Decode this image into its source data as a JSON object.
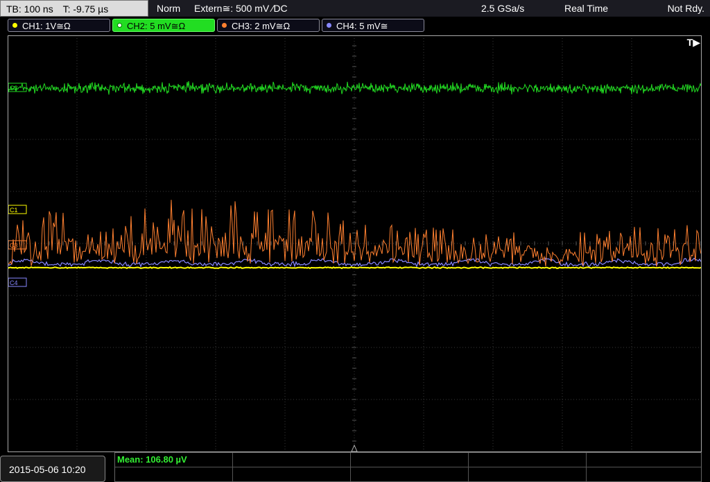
{
  "topbar": {
    "timebase": "TB: 100 ns",
    "trigger_time": "T: -9.75 µs",
    "trigger_mode": "Norm",
    "trigger_source": "Extern≅: 500 mV ∕DC",
    "sample_rate": "2.5 GSa/s",
    "acquisition_mode": "Real Time",
    "trigger_status": "Not Rdy."
  },
  "channels": [
    {
      "label": "CH1: 1V≅Ω",
      "color": "#ffff00",
      "active": false
    },
    {
      "label": "CH2: 5 mV≅Ω",
      "color": "#22dd22",
      "active": true
    },
    {
      "label": "CH3: 2 mV≅Ω",
      "color": "#ff8030",
      "active": false
    },
    {
      "label": "CH4: 5 mV≅",
      "color": "#8080ff",
      "active": false
    }
  ],
  "markers": {
    "c1": "C1",
    "c2": "C2",
    "c3": "C3",
    "c4": "C4",
    "trigger_indicator": "T▶"
  },
  "colors": {
    "ch1": "#ffff00",
    "ch2": "#22dd22",
    "ch3": "#ff8030",
    "ch4": "#8888ff",
    "grid": "#3a3a3a",
    "grid_border": "#aaaaaa"
  },
  "datetime": "2015-05-06 10:20",
  "measurement": {
    "label": "Mean: 106.80 µV"
  }
}
